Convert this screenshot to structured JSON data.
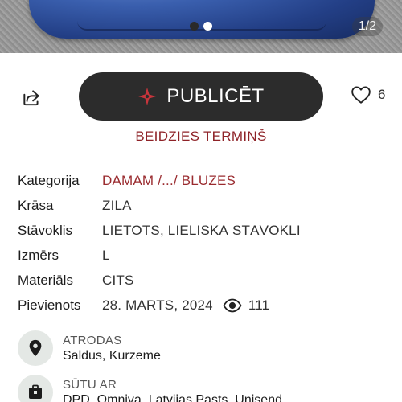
{
  "gallery": {
    "counter": "1/2",
    "dots": 2,
    "active_dot": 1
  },
  "actions": {
    "share_icon": "share-icon",
    "publish_label": "PUBLICĒT",
    "publish_icon": "four-point-star-icon",
    "like_icon": "heart-outline-icon",
    "like_count": "6"
  },
  "status_text": "BEIDZIES TERMIŅŠ",
  "details": {
    "category_label": "Kategorija",
    "category_value": "DĀMĀM /.../ BLŪZES",
    "color_label": "Krāsa",
    "color_value": "ZILA",
    "condition_label": "Stāvoklis",
    "condition_value": "LIETOTS, LIELISKĀ STĀVOKLĪ",
    "size_label": "Izmērs",
    "size_value": "L",
    "material_label": "Materiāls",
    "material_value": "CITS",
    "added_label": "Pievienots",
    "added_value": "28. MARTS, 2024",
    "views": "111"
  },
  "location": {
    "label": "ATRODAS",
    "value": "Saldus, Kurzeme",
    "icon": "map-pin-icon"
  },
  "shipping": {
    "label": "SŪTU AR",
    "value": "DPD, Omniva, Latvijas Pasts, Unisend",
    "icon": "package-icon"
  },
  "colors": {
    "primary_button": "#2c2c2c",
    "accent": "#9a2b2f",
    "status": "#8e2227",
    "icon_circle": "#e4e8e5"
  }
}
